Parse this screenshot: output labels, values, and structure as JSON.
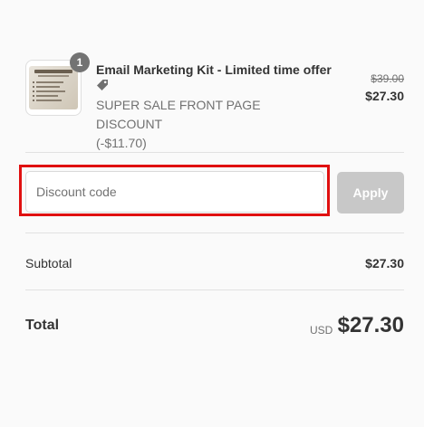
{
  "product": {
    "quantity": "1",
    "title": "Email Marketing Kit - Limited time offer",
    "discount_name": "SUPER SALE FRONT PAGE DISCOUNT",
    "discount_amount": "(-$11.70)",
    "original_price": "$39.00",
    "price": "$27.30",
    "icons": {
      "tag": "tag-icon"
    }
  },
  "discount": {
    "placeholder": "Discount code",
    "value": "",
    "apply_label": "Apply"
  },
  "summary": {
    "subtotal_label": "Subtotal",
    "subtotal_value": "$27.30",
    "total_label": "Total",
    "currency": "USD",
    "total_value": "$27.30"
  },
  "colors": {
    "highlight": "#e01010",
    "apply_disabled": "#c8c8c8",
    "badge": "#737373",
    "text": "#333333",
    "muted": "#717171"
  }
}
